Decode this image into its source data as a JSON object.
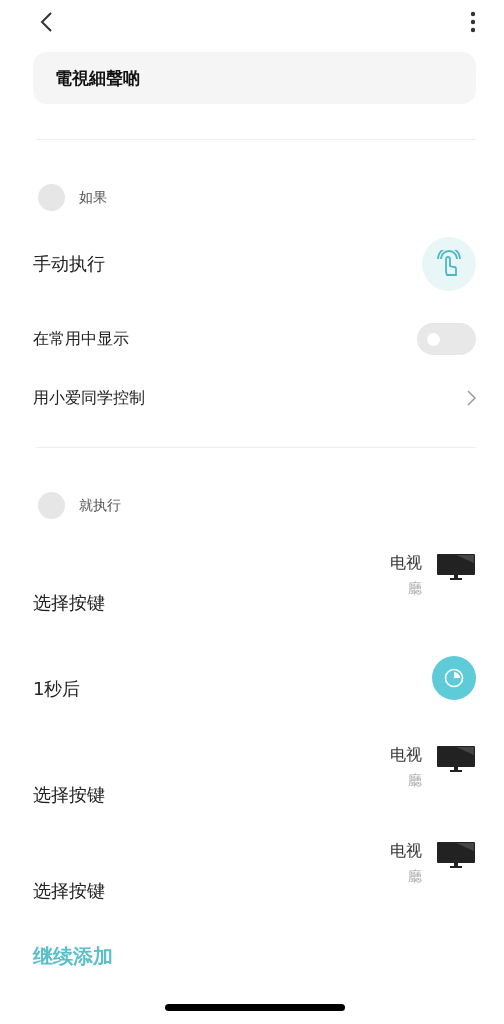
{
  "title_field": {
    "value": "電視細聲啲"
  },
  "condition_section": {
    "label": "如果"
  },
  "manual": {
    "label": "手动执行"
  },
  "settings": [
    {
      "kind": "toggle",
      "label": "在常用中显示",
      "on": false
    },
    {
      "kind": "link",
      "label": "用小爱同学控制"
    }
  ],
  "action_section": {
    "label": "就执行"
  },
  "actions": [
    {
      "kind": "device",
      "label": "选择按键",
      "device": "电视",
      "room": "廳"
    },
    {
      "kind": "delay",
      "label": "1秒后"
    },
    {
      "kind": "device",
      "label": "选择按键",
      "device": "电视",
      "room": "廳"
    },
    {
      "kind": "device",
      "label": "选择按键",
      "device": "电视",
      "room": "廳"
    }
  ],
  "add_button": {
    "label": "继续添加"
  }
}
